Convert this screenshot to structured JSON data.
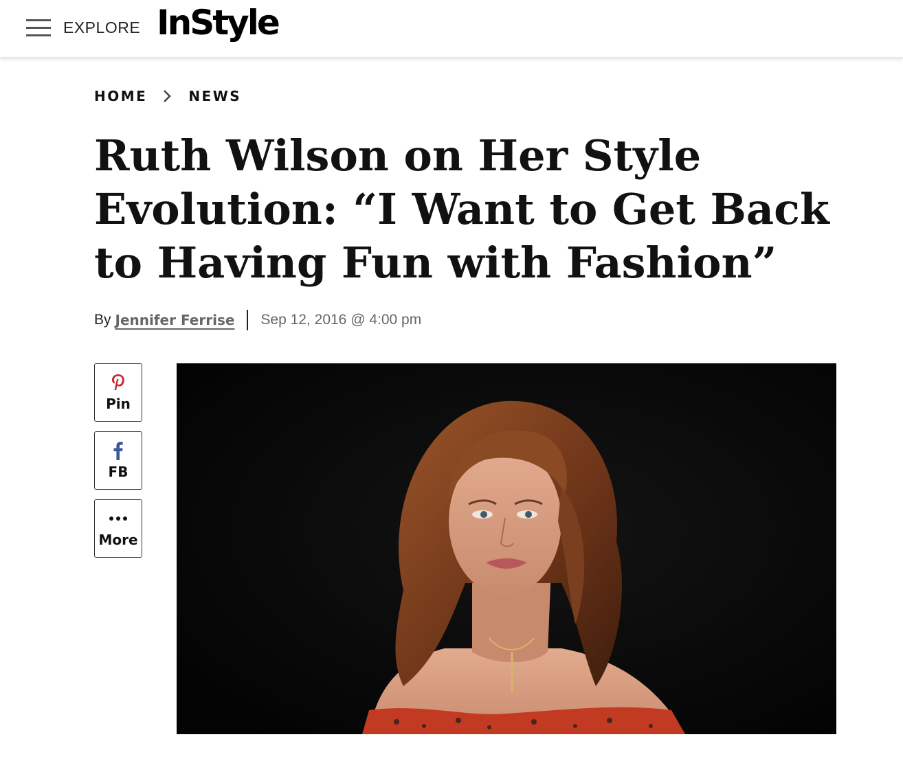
{
  "header": {
    "explore_label": "EXPLORE",
    "logo_text": "InStyle"
  },
  "breadcrumb": {
    "items": [
      "HOME",
      "NEWS"
    ]
  },
  "article": {
    "headline_lines": [
      "Ruth Wilson on Her Style",
      "Evolution: “I Want to Get Back",
      "to Having Fun with Fashion”"
    ],
    "by_label": "By",
    "author": "Jennifer Ferrise",
    "date": "Sep 12, 2016 @ 4:00 pm"
  },
  "share": {
    "pin": {
      "label": "Pin",
      "icon": "pinterest-icon",
      "color": "#c8232c"
    },
    "fb": {
      "label": "FB",
      "icon": "facebook-icon",
      "color": "#3b5998"
    },
    "more": {
      "label": "More",
      "icon": "more-dots-icon",
      "color": "#111111"
    }
  },
  "hero_image": {
    "background_color": "#050505",
    "hair_color": "#7a3f1f",
    "skin_color": "#d9a185",
    "dress_color": "#c23a22"
  }
}
